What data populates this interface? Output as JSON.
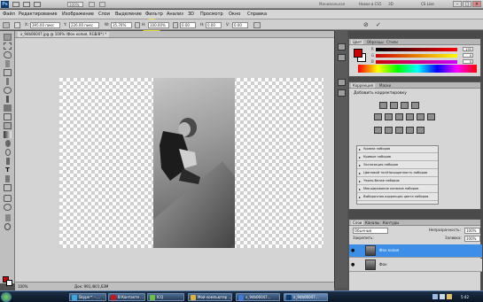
{
  "app": {
    "logo": "Ps",
    "zoom": "100%",
    "workspace_label": "Минимальная",
    "workspace_btns": [
      "Новое в CS5",
      "3D"
    ],
    "cs_live": "CS Live"
  },
  "menu": {
    "items": [
      "Файл",
      "Редактирование",
      "Изображение",
      "Слои",
      "Выделение",
      "Фильтр",
      "Анализ",
      "3D",
      "Просмотр",
      "Окно",
      "Справка"
    ]
  },
  "options": {
    "x_label": "X:",
    "x_value": "395.00 пикс",
    "y_label": "Y:",
    "y_value": "226.00 пикс",
    "w_label": "W:",
    "w_value": "35.76%",
    "h_label": "H:",
    "h_value": "100.00%",
    "angle_value": "0.00",
    "h_skew_label": "H:",
    "h_skew_value": "0.00",
    "v_skew_label": "V:",
    "v_skew_value": "0.00"
  },
  "document": {
    "tab_title": "x_9db06047.jpg @ 100% (Фон копия, RGB/8*) *",
    "status_zoom": "100%",
    "status_doc": "Док: 991,4K/1,63M"
  },
  "color_panel": {
    "tabs": [
      "Цвет",
      "Образцы",
      "Стили"
    ],
    "r_label": "R",
    "g_label": "G",
    "b_label": "B",
    "r_value": "195",
    "g_value": "0",
    "b_value": "0"
  },
  "adjustments": {
    "tabs": [
      "Коррекция",
      "Маски"
    ],
    "title": "Добавить корректировку",
    "presets": [
      "Уровни наборов",
      "Кривые наборов",
      "Экспозиция наборов",
      "Цветовой тон/Насыщенность наборов",
      "Черно-белое наборов",
      "Микширование каналов наборов",
      "Выборочная коррекция цвета наборов"
    ]
  },
  "layers": {
    "tabs": [
      "Слои",
      "Каналы",
      "Контуры"
    ],
    "blend_mode": "Обычные",
    "opacity_label": "Непрозрачность:",
    "opacity_value": "100%",
    "lock_label": "Закрепить:",
    "fill_label": "Заливка:",
    "fill_value": "100%",
    "items": [
      {
        "name": "Фон копия",
        "active": true
      },
      {
        "name": "Фон",
        "active": false
      }
    ]
  },
  "taskbar": {
    "items": [
      "Skype™ - ...",
      "В Контакте ...",
      "ICQ",
      "Мой компьютер ...",
      "x_9db06047...",
      "x_9db06047..."
    ],
    "clock": "5:42"
  },
  "colors": {
    "foreground": "#cc0000",
    "background": "#ffffff",
    "layer_highlight": "#3d8ee6",
    "menu_highlight": "#fff84a"
  }
}
